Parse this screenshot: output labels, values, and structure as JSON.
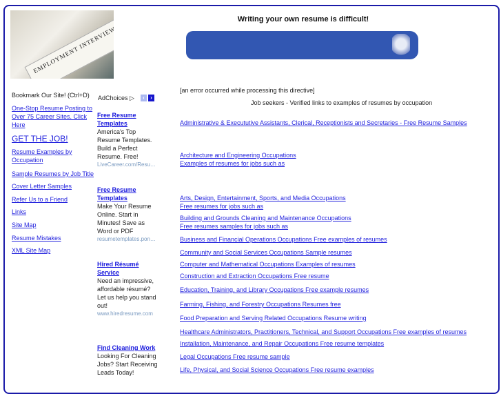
{
  "header": {
    "title": "Writing your own resume is difficult!",
    "photo_caption": "EMPLOYMENT INTERVIEW"
  },
  "sidebar": {
    "bookmark": "Bookmark Our Site! (Ctrl+D)",
    "items": [
      {
        "label": "One-Stop Resume Posting to"
      },
      {
        "label": "Over 75 Career Sites. Click"
      },
      {
        "label": "Here"
      },
      {
        "label": "GET THE JOB!"
      },
      {
        "label": "Resume Examples by"
      },
      {
        "label": "Occupation"
      },
      {
        "label": "Sample Resumes by Job Title"
      },
      {
        "label": "Cover Letter Samples"
      },
      {
        "label": "Refer Us to a Friend"
      },
      {
        "label": "Links"
      },
      {
        "label": "Site Map"
      },
      {
        "label": "Resume Mistakes"
      },
      {
        "label": "XML Site Map"
      }
    ]
  },
  "ads": {
    "adchoices": "AdChoices",
    "items": [
      {
        "title": [
          "Free Resume",
          "Templates"
        ],
        "body": [
          "America's Top",
          "Resume Templates.",
          "Build a Perfect",
          "Resume. Free!"
        ],
        "url": "LiveCareer.com/Resu…"
      },
      {
        "title": [
          "Free Resume",
          "Templates"
        ],
        "body": [
          "Make Your Resume",
          "Online. Start in",
          "Minutes! Save as",
          "Word or PDF"
        ],
        "url": "resumetemplates.pon…"
      },
      {
        "title": [
          "Hired Résumé",
          "Service"
        ],
        "body": [
          "Need an impressive,",
          "affordable résumé?",
          "Let us help you stand",
          "out!"
        ],
        "url": "www.hiredresume.com"
      },
      {
        "title": [
          "Find Cleaning Work"
        ],
        "body": [
          "Looking For Cleaning",
          "Jobs? Start Receiving",
          "Leads Today!"
        ],
        "url": ""
      }
    ]
  },
  "main": {
    "error": "[an error occurred while processing this directive]",
    "intro": "Job seekers - Verified links to examples of resumes by occupation",
    "links": [
      "Administrative & Execututive Assistants, Clerical, Receptionists and Secretaries - Free Resume Samples",
      "Architecture and Engineering Occupations",
      "Examples of resumes for jobs such as",
      "Arts, Design, Entertainment, Sports, and Media Occupations",
      "Free resumes for jobs such as",
      "Building and Grounds Cleaning and Maintenance Occupations",
      "Free resumes samples for jobs such as",
      "Business and Financial Operations Occupations Free examples of resumes",
      "Community and Social Services Occupations Sample resumes",
      "Computer and Mathematical Occupations Examples of resumes",
      "Construction and Extraction Occupations Free resume",
      "Education, Training, and Library Occupations Free example resumes",
      "Farming, Fishing, and Forestry Occupations Resumes free",
      "Food Preparation and Serving Related Occupations Resume writing",
      "Healthcare Administrators, Practitioners, Technical, and Support Occupations Free examples of resumes",
      "Installation, Maintenance, and Repair Occupations Free resume templates",
      "Legal Occupations Free resume sample",
      "Life, Physical, and Social Science Occupations Free resume examples"
    ]
  }
}
